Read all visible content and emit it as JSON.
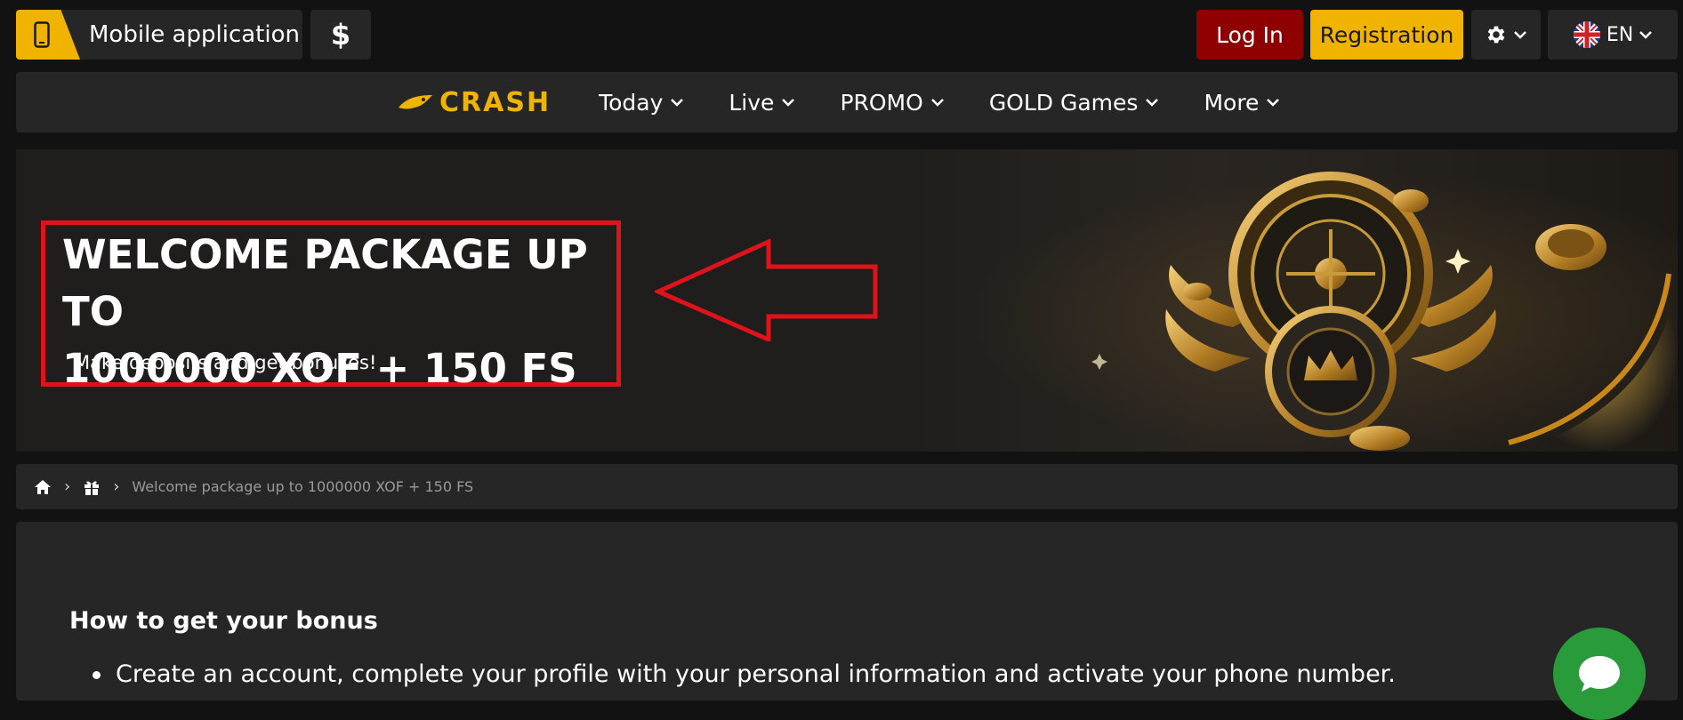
{
  "topbar": {
    "mobile_app_label": "Mobile application",
    "currency_symbol": "$",
    "login_label": "Log In",
    "register_label": "Registration",
    "language_label": "EN"
  },
  "nav": {
    "logo_text": "CRASH",
    "items": [
      {
        "label": "Today"
      },
      {
        "label": "Live"
      },
      {
        "label": "PROMO"
      },
      {
        "label": "GOLD Games"
      },
      {
        "label": "More"
      }
    ]
  },
  "banner": {
    "title_line1": "WELCOME PACKAGE UP TO",
    "title_line2": "1000000 XOF + 150 FS",
    "subtitle": "Make deposits and get bonuses!"
  },
  "breadcrumb": {
    "current": "Welcome package up to 1000000 XOF + 150 FS"
  },
  "content": {
    "heading": "How to get your bonus",
    "list": [
      "Create an account, complete your profile with your personal information and activate your phone number."
    ]
  },
  "colors": {
    "accent_yellow": "#f0b400",
    "login_red": "#8f0000",
    "annotation_red": "#e0131a",
    "chat_green": "#2a9b3a"
  }
}
